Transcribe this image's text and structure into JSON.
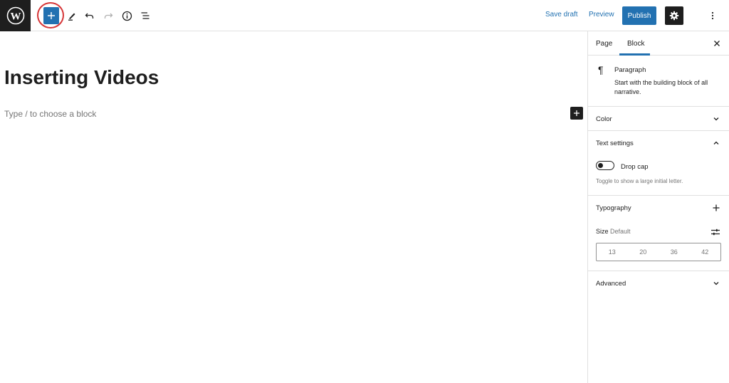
{
  "toolbar": {
    "save_draft": "Save draft",
    "preview": "Preview",
    "publish": "Publish"
  },
  "editor": {
    "title": "Inserting Videos",
    "placeholder": "Type / to choose a block"
  },
  "sidebar": {
    "tabs": [
      "Page",
      "Block"
    ],
    "active_tab": "Block",
    "block": {
      "name": "Paragraph",
      "description": "Start with the building block of all narrative."
    },
    "color_panel": {
      "title": "Color"
    },
    "text_settings": {
      "title": "Text settings",
      "drop_cap_label": "Drop cap",
      "drop_cap_help": "Toggle to show a large initial letter.",
      "drop_cap_enabled": false
    },
    "typography": {
      "title": "Typography",
      "size_label": "Size",
      "size_value": "Default",
      "sizes": [
        "13",
        "20",
        "36",
        "42"
      ]
    },
    "advanced": {
      "title": "Advanced"
    }
  },
  "colors": {
    "accent": "#2271b1",
    "dark": "#1e1e1e",
    "highlight": "#d63638"
  },
  "icons": [
    "wordpress-logo-icon",
    "plus-icon",
    "pencil-icon",
    "undo-icon",
    "redo-icon",
    "info-icon",
    "list-view-icon",
    "gear-icon",
    "more-vertical-icon",
    "close-icon",
    "pilcrow-icon",
    "chevron-down-icon",
    "chevron-up-icon",
    "sliders-icon"
  ]
}
